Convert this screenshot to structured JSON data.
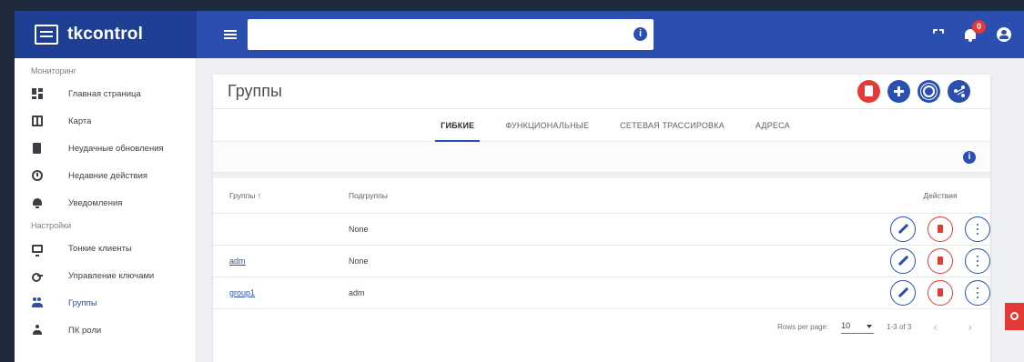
{
  "app": {
    "name": "tkcontrol"
  },
  "search": {
    "placeholder": "",
    "info_glyph": "i"
  },
  "header": {
    "notification_count": "0"
  },
  "sidebar": {
    "sections": [
      {
        "title": "Мониторинг",
        "items": [
          {
            "label": "Главная страница",
            "icon": "dashboard-icon"
          },
          {
            "label": "Карта",
            "icon": "map-icon"
          },
          {
            "label": "Неудачные обновления",
            "icon": "file-icon"
          },
          {
            "label": "Недавние действия",
            "icon": "history-icon"
          },
          {
            "label": "Уведомления",
            "icon": "bell-icon"
          }
        ]
      },
      {
        "title": "Настройки",
        "items": [
          {
            "label": "Тонкие клиенты",
            "icon": "monitor-icon"
          },
          {
            "label": "Управление ключами",
            "icon": "key-icon"
          },
          {
            "label": "Группы",
            "icon": "people-icon",
            "active": true
          },
          {
            "label": "ПК роли",
            "icon": "person-icon"
          }
        ]
      }
    ]
  },
  "page": {
    "title": "Группы",
    "tabs": [
      {
        "label": "ГИБКИЕ",
        "active": true
      },
      {
        "label": "ФУНКЦИОНАЛЬНЫЕ"
      },
      {
        "label": "СЕТЕВАЯ ТРАССИРОВКА"
      },
      {
        "label": "АДРЕСА"
      }
    ],
    "filter_info_glyph": "i"
  },
  "table": {
    "columns": [
      "Группы",
      "Подгруппы",
      "Действия"
    ],
    "sort_arrow": "↑",
    "rows": [
      {
        "group": "",
        "subgroup": "None"
      },
      {
        "group": "adm",
        "subgroup": "None"
      },
      {
        "group": "group1",
        "subgroup": "adm"
      }
    ]
  },
  "pagination": {
    "rows_per_page_label": "Rows per page:",
    "rows_per_page_value": "10",
    "range": "1-3 of 3",
    "prev": "‹",
    "next": "›"
  },
  "colors": {
    "primary": "#2a4fb0",
    "danger": "#e53935",
    "brand_dark": "#1f3f94"
  }
}
